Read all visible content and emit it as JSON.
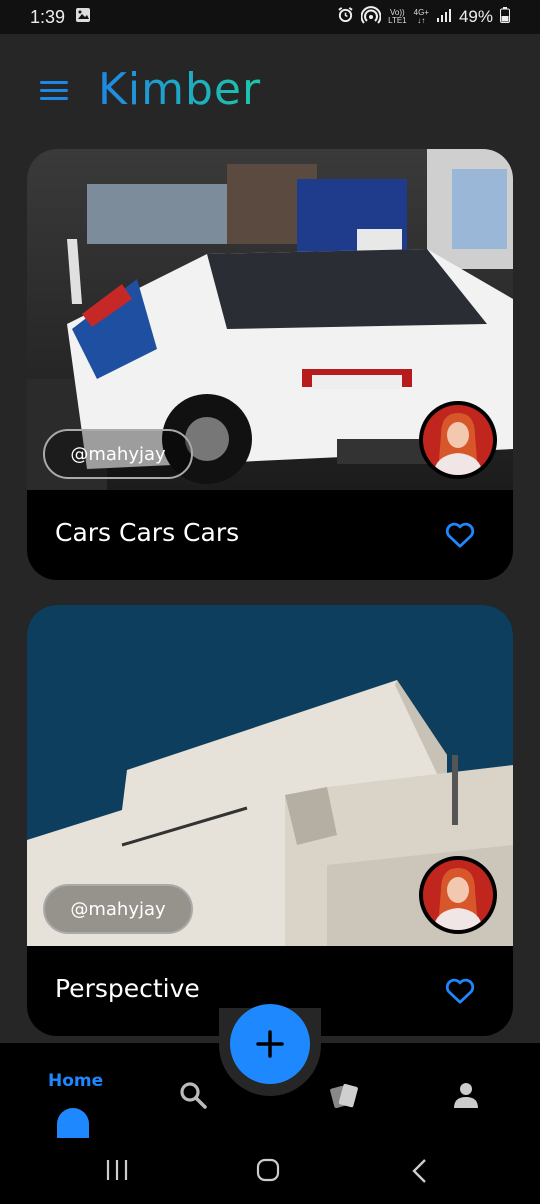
{
  "status_bar": {
    "time": "1:39",
    "volte_top": "Vo))",
    "volte_bottom": "LTE1",
    "net_top": "4G+",
    "net_bottom": "↓↑",
    "battery": "49%"
  },
  "header": {
    "title": "Kimber"
  },
  "feed": {
    "posts": [
      {
        "title": "Cars Cars Cars",
        "author": "@mahyjay"
      },
      {
        "title": "Perspective",
        "author": "@mahyjay"
      }
    ]
  },
  "nav": {
    "home_label": "Home",
    "accent": "#1e88ff"
  },
  "icons": {
    "menu": "menu-icon",
    "like": "heart-outline-icon",
    "add": "plus-icon",
    "search": "search-icon",
    "cards": "cards-icon",
    "profile": "person-icon"
  }
}
